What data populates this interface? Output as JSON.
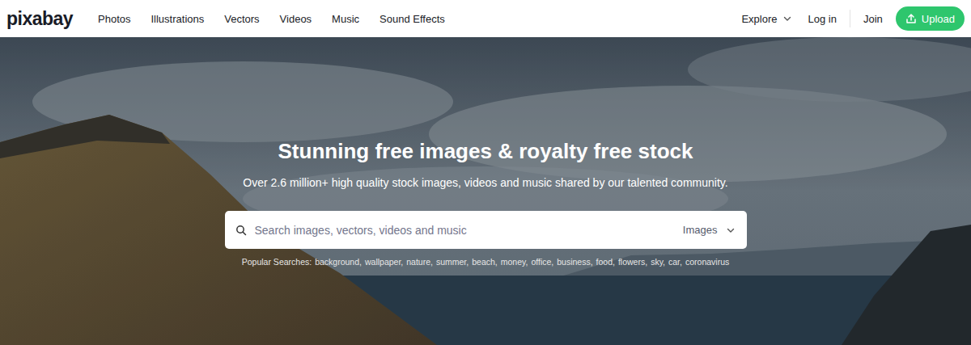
{
  "logo": "pixabay",
  "nav": [
    {
      "label": "Photos"
    },
    {
      "label": "Illustrations"
    },
    {
      "label": "Vectors"
    },
    {
      "label": "Videos"
    },
    {
      "label": "Music"
    },
    {
      "label": "Sound Effects"
    }
  ],
  "header_actions": {
    "explore": "Explore",
    "login": "Log in",
    "join": "Join",
    "upload": "Upload"
  },
  "hero": {
    "title": "Stunning free images & royalty free stock",
    "subtitle": "Over 2.6 million+ high quality stock images, videos and music shared by our talented community."
  },
  "search": {
    "placeholder": "Search images, vectors, videos and music",
    "type": "Images"
  },
  "popular": {
    "label": "Popular Searches:",
    "separator": ",",
    "terms": [
      "background",
      "wallpaper",
      "nature",
      "summer",
      "beach",
      "money",
      "office",
      "business",
      "food",
      "flowers",
      "sky",
      "car",
      "coronavirus"
    ]
  }
}
